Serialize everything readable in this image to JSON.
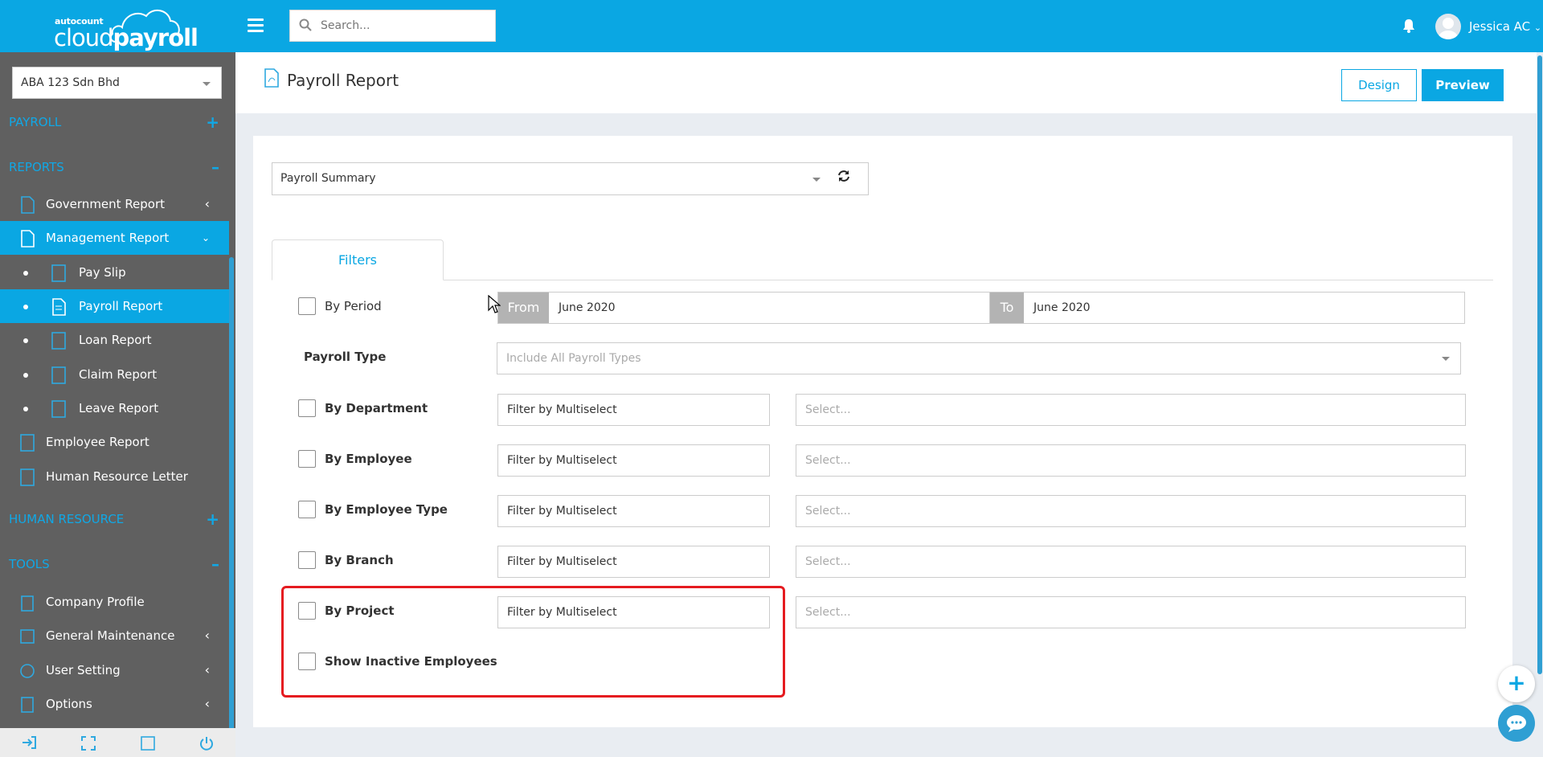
{
  "brand": {
    "small": "autocount",
    "name_light": "cloud",
    "name_bold": "payroll"
  },
  "search": {
    "placeholder": "Search..."
  },
  "user": {
    "name": "Jessica AC"
  },
  "sidebar": {
    "company": "ABA 123 Sdn Bhd",
    "sections": [
      {
        "label": "PAYROLL",
        "toggle": "+"
      },
      {
        "label": "REPORTS",
        "toggle": "–"
      },
      {
        "label": "HUMAN RESOURCE",
        "toggle": "+"
      },
      {
        "label": "TOOLS",
        "toggle": "–"
      }
    ],
    "items": [
      {
        "label": "Government Report"
      },
      {
        "label": "Management Report"
      },
      {
        "label": "Pay Slip"
      },
      {
        "label": "Payroll Report"
      },
      {
        "label": "Loan Report"
      },
      {
        "label": "Claim Report"
      },
      {
        "label": "Leave Report"
      },
      {
        "label": "Employee Report"
      },
      {
        "label": "Human Resource Letter"
      },
      {
        "label": "Company Profile"
      },
      {
        "label": "General Maintenance"
      },
      {
        "label": "User Setting"
      },
      {
        "label": "Options"
      }
    ]
  },
  "header": {
    "title": "Payroll Report",
    "design_label": "Design",
    "preview_label": "Preview"
  },
  "report": {
    "selected": "Payroll Summary"
  },
  "tabs": {
    "filters": "Filters"
  },
  "filters": {
    "period": {
      "label": "By Period",
      "from_label": "From",
      "from_value": "June 2020",
      "to_label": "To",
      "to_value": "June 2020"
    },
    "payroll_type": {
      "label": "Payroll Type",
      "placeholder": "Include All Payroll Types"
    },
    "rows": [
      {
        "label": "By Department",
        "mode": "Filter by Multiselect",
        "placeholder": "Select..."
      },
      {
        "label": "By Employee",
        "mode": "Filter by Multiselect",
        "placeholder": "Select..."
      },
      {
        "label": "By Employee Type",
        "mode": "Filter by Multiselect",
        "placeholder": "Select..."
      },
      {
        "label": "By Branch",
        "mode": "Filter by Multiselect",
        "placeholder": "Select..."
      },
      {
        "label": "By Project",
        "mode": "Filter by Multiselect",
        "placeholder": "Select..."
      }
    ],
    "inactive": {
      "label": "Show Inactive Employees"
    }
  },
  "colors": {
    "accent": "#0aa7e3",
    "sidebar_bg": "#606060",
    "highlight": "#e51b20"
  }
}
